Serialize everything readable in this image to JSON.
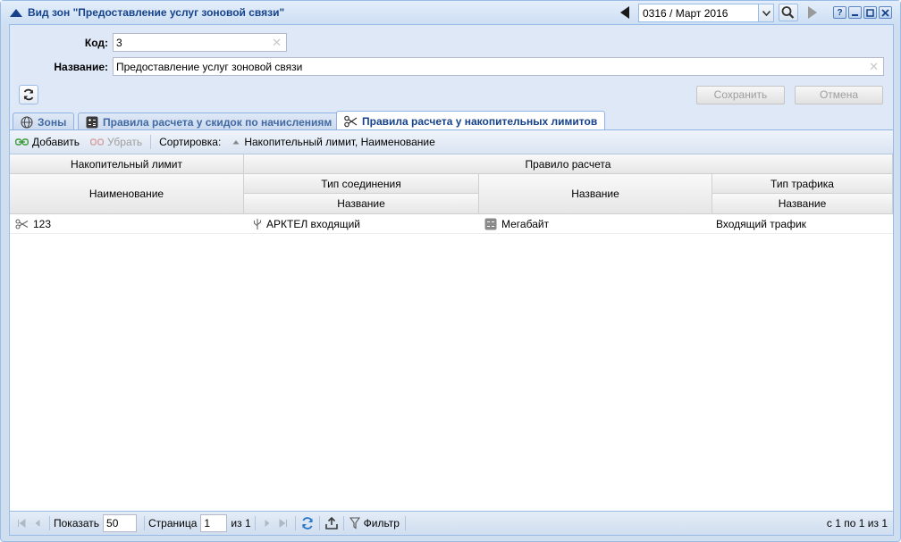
{
  "window": {
    "title": "Вид зон \"Предоставление услуг зоновой связи\"",
    "period": "0316 / Март 2016",
    "help_label": "?"
  },
  "form": {
    "code_label": "Код:",
    "code_value": "3",
    "name_label": "Название:",
    "name_value": "Предоставление услуг зоновой связи",
    "save_label": "Сохранить",
    "cancel_label": "Отмена"
  },
  "tabs": [
    {
      "label": "Зоны",
      "icon": "globe-icon"
    },
    {
      "label": "Правила расчета у скидок по начислениям",
      "icon": "calculator-icon"
    },
    {
      "label": "Правила расчета у накопительных лимитов",
      "icon": "scissors-icon",
      "active": true
    }
  ],
  "toolbar": {
    "add_label": "Добавить",
    "remove_label": "Убрать",
    "sort_label": "Сортировка:",
    "sort_value": "Накопительный лимит, Наименование"
  },
  "grid": {
    "group_limit": "Накопительный лимит",
    "group_rule": "Правило расчета",
    "col_name": "Наименование",
    "col_conn_type": "Тип соединения",
    "col_conn_name": "Название",
    "col_rule_name": "Название",
    "col_traffic_type": "Тип трафика",
    "col_traffic_name": "Название",
    "rows": [
      {
        "name": "123",
        "conn": "АРКТЕЛ входящий",
        "rule": "Мегабайт",
        "traffic": "Входящий трафик"
      }
    ]
  },
  "pager": {
    "show_label": "Показать",
    "page_size": "50",
    "page_label": "Страница",
    "page_value": "1",
    "of_label": "из 1",
    "filter_label": "Фильтр",
    "summary": "с 1 по 1 из 1"
  },
  "colors": {
    "title": "#15428b",
    "panel_bg": "#dfe8f6",
    "border": "#99bbe8"
  }
}
